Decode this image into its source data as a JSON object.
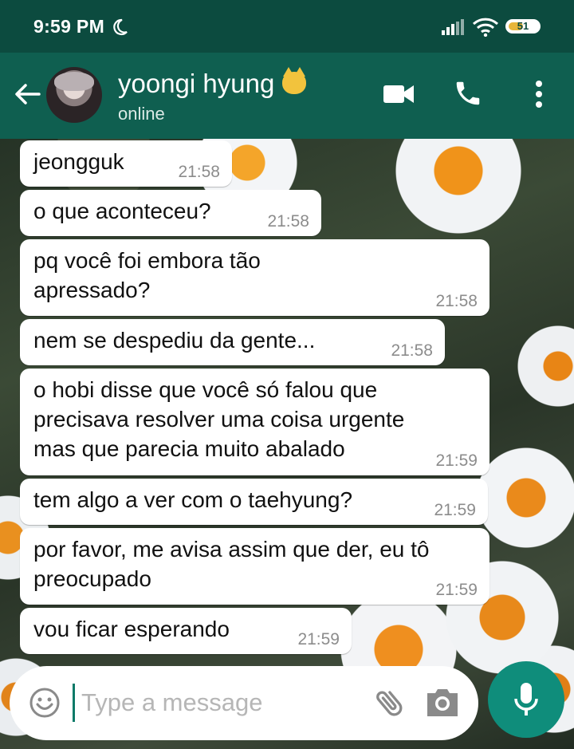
{
  "status_bar": {
    "time": "9:59 PM",
    "battery": "51",
    "battery_level": 0.51
  },
  "header": {
    "contact_name": "yoongi hyung",
    "contact_status": "online",
    "icons": [
      "back-arrow-icon",
      "video-call-icon",
      "voice-call-icon",
      "more-options-icon"
    ]
  },
  "messages": [
    {
      "text": "jeongguk",
      "time": "21:58"
    },
    {
      "text": "o que aconteceu?",
      "time": "21:58"
    },
    {
      "text": "pq você foi embora tão\napressado?",
      "time": "21:58"
    },
    {
      "text": "nem se despediu da gente...",
      "time": "21:58"
    },
    {
      "text": "o hobi disse que você só falou que\nprecisava resolver uma coisa urgente\nmas que parecia muito abalado",
      "time": "21:59"
    },
    {
      "text": "tem algo a ver com o taehyung?",
      "time": "21:59"
    },
    {
      "text": "por favor, me avisa assim que der, eu tô\npreocupado",
      "time": "21:59"
    },
    {
      "text": "vou ficar esperando",
      "time": "21:59"
    }
  ],
  "composer": {
    "placeholder": "Type a message",
    "icons": [
      "emoji-icon",
      "attach-icon",
      "camera-icon",
      "mic-icon"
    ]
  }
}
